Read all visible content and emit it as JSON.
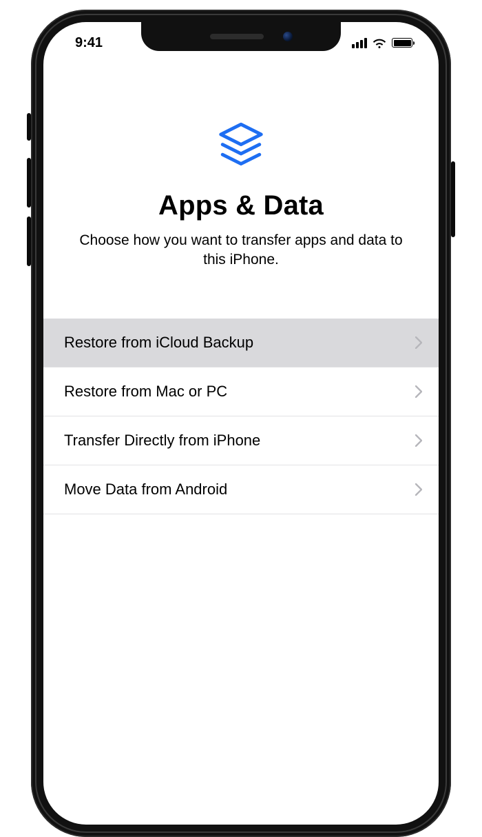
{
  "status_bar": {
    "time": "9:41"
  },
  "header": {
    "title": "Apps & Data",
    "subtitle": "Choose how you want to transfer apps and data to this iPhone."
  },
  "options": [
    {
      "label": "Restore from iCloud Backup",
      "selected": true
    },
    {
      "label": "Restore from Mac or PC",
      "selected": false
    },
    {
      "label": "Transfer Directly from iPhone",
      "selected": false
    },
    {
      "label": "Move Data from Android",
      "selected": false
    }
  ],
  "colors": {
    "accent": "#1e6ef2",
    "selected_bg": "#d9d9dc",
    "chevron": "#b6b6bb"
  }
}
